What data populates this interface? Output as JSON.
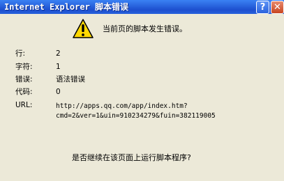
{
  "window": {
    "title": "Internet Explorer 脚本错误",
    "help_label": "?",
    "close_label": "✕"
  },
  "dialog": {
    "message": "当前页的脚本发生错误。",
    "icon": "warning-icon",
    "details": {
      "line_label": "行:",
      "line_value": "2",
      "char_label": "字符:",
      "char_value": "1",
      "error_label": "错误:",
      "error_value": "语法错误",
      "code_label": "代码:",
      "code_value": "0",
      "url_label": "URL:",
      "url_line1": "http://apps.qq.com/app/index.htm?",
      "url_line2": "cmd=2&ver=1&uin=910234279&fuin=382119005"
    },
    "question": "是否继续在该页面上运行脚本程序?"
  },
  "colors": {
    "titlebar": "#2a66df",
    "background": "#ece9d8",
    "warning_yellow": "#ffd800"
  }
}
